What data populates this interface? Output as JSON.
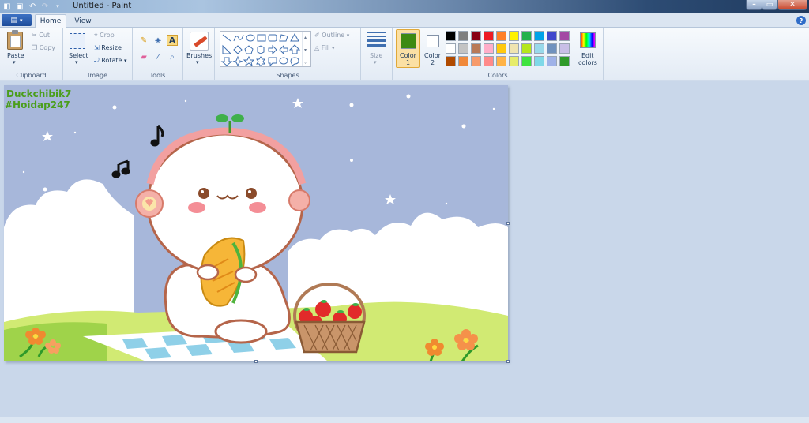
{
  "window": {
    "title": "Untitled - Paint"
  },
  "tabs": {
    "home": "Home",
    "view": "View"
  },
  "clipboard": {
    "paste": "Paste",
    "cut": "Cut",
    "copy": "Copy",
    "group": "Clipboard"
  },
  "image": {
    "select": "Select",
    "crop": "Crop",
    "resize": "Resize",
    "rotate": "Rotate",
    "group": "Image"
  },
  "tools": {
    "group": "Tools",
    "text_glyph": "A"
  },
  "brushes": {
    "label": "Brushes"
  },
  "shapes": {
    "outline": "Outline",
    "fill": "Fill",
    "group": "Shapes"
  },
  "size": {
    "label": "Size"
  },
  "colors": {
    "color1_label": "Color",
    "color1_num": "1",
    "color2_label": "Color",
    "color2_num": "2",
    "edit_label": "Edit",
    "edit_label2": "colors",
    "group": "Colors",
    "color1": "#3d8a12",
    "color2": "#ffffff",
    "palette_row1": [
      "#000000",
      "#7f7f7f",
      "#880015",
      "#ed1c24",
      "#ff7f27",
      "#fff200",
      "#22b14c",
      "#00a2e8",
      "#3f48cc",
      "#a349a4"
    ],
    "palette_row2": [
      "#ffffff",
      "#c3c3c3",
      "#b97a57",
      "#ffaec9",
      "#ffc90e",
      "#efe4b0",
      "#b5e61d",
      "#99d9ea",
      "#7092be",
      "#c8bfe7"
    ],
    "palette_row3": [
      "#b04a00",
      "#f0883a",
      "#f79a6a",
      "#ff8a8a",
      "#ffb347",
      "#e6ec6a",
      "#3fe33f",
      "#7fd8e8",
      "#9fb2e8",
      "#2f9a2a"
    ]
  },
  "artwork": {
    "watermark_line1": "Duckchibik7",
    "watermark_line2": "#Hoidap247"
  }
}
